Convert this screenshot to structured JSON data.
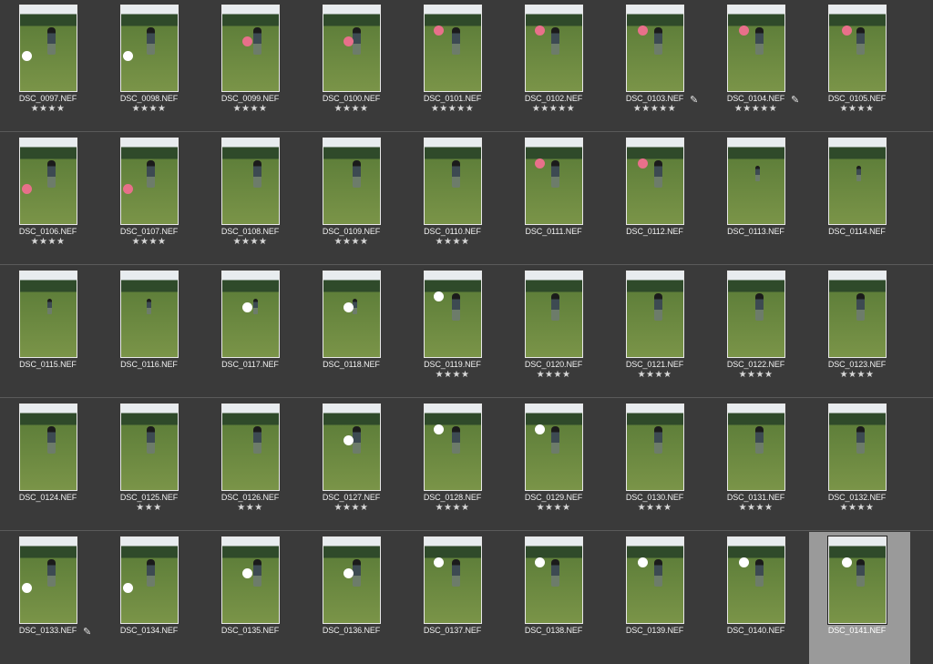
{
  "rows": [
    [
      {
        "name": "DSC_0097.NEF",
        "stars": "★★★★",
        "ball": "#ffffff",
        "pen": false
      },
      {
        "name": "DSC_0098.NEF",
        "stars": "★★★★",
        "ball": "#ffffff",
        "pen": false
      },
      {
        "name": "DSC_0099.NEF",
        "stars": "★★★★",
        "ball": "#e8708a",
        "pen": false
      },
      {
        "name": "DSC_0100.NEF",
        "stars": "★★★★",
        "ball": "#e8708a",
        "pen": false
      },
      {
        "name": "DSC_0101.NEF",
        "stars": "★★★★★",
        "ball": "#e8708a",
        "pen": false
      },
      {
        "name": "DSC_0102.NEF",
        "stars": "★★★★★",
        "ball": "#e8708a",
        "pen": false
      },
      {
        "name": "DSC_0103.NEF",
        "stars": "★★★★★",
        "ball": "#e8708a",
        "pen": true
      },
      {
        "name": "DSC_0104.NEF",
        "stars": "★★★★★",
        "ball": "#e8708a",
        "pen": true
      },
      {
        "name": "DSC_0105.NEF",
        "stars": "★★★★",
        "ball": "#e8708a",
        "pen": false
      }
    ],
    [
      {
        "name": "DSC_0106.NEF",
        "stars": "★★★★",
        "ball": "#e8708a",
        "pen": false
      },
      {
        "name": "DSC_0107.NEF",
        "stars": "★★★★",
        "ball": "#e8708a",
        "pen": false
      },
      {
        "name": "DSC_0108.NEF",
        "stars": "★★★★",
        "ball": "",
        "pen": false
      },
      {
        "name": "DSC_0109.NEF",
        "stars": "★★★★",
        "ball": "",
        "pen": false
      },
      {
        "name": "DSC_0110.NEF",
        "stars": "★★★★",
        "ball": "",
        "pen": false
      },
      {
        "name": "DSC_0111.NEF",
        "stars": "",
        "ball": "#e8708a",
        "pen": false
      },
      {
        "name": "DSC_0112.NEF",
        "stars": "",
        "ball": "#e8708a",
        "pen": false
      },
      {
        "name": "DSC_0113.NEF",
        "stars": "",
        "ball": "",
        "pen": false
      },
      {
        "name": "DSC_0114.NEF",
        "stars": "",
        "ball": "",
        "pen": false
      }
    ],
    [
      {
        "name": "DSC_0115.NEF",
        "stars": "",
        "ball": "",
        "pen": false
      },
      {
        "name": "DSC_0116.NEF",
        "stars": "",
        "ball": "",
        "pen": false
      },
      {
        "name": "DSC_0117.NEF",
        "stars": "",
        "ball": "#ffffff",
        "pen": false
      },
      {
        "name": "DSC_0118.NEF",
        "stars": "",
        "ball": "#ffffff",
        "pen": false
      },
      {
        "name": "DSC_0119.NEF",
        "stars": "★★★★",
        "ball": "#ffffff",
        "pen": false
      },
      {
        "name": "DSC_0120.NEF",
        "stars": "★★★★",
        "ball": "",
        "pen": false
      },
      {
        "name": "DSC_0121.NEF",
        "stars": "★★★★",
        "ball": "",
        "pen": false
      },
      {
        "name": "DSC_0122.NEF",
        "stars": "★★★★",
        "ball": "",
        "pen": false
      },
      {
        "name": "DSC_0123.NEF",
        "stars": "★★★★",
        "ball": "",
        "pen": false
      }
    ],
    [
      {
        "name": "DSC_0124.NEF",
        "stars": "",
        "ball": "",
        "pen": false
      },
      {
        "name": "DSC_0125.NEF",
        "stars": "★★★",
        "ball": "",
        "pen": false
      },
      {
        "name": "DSC_0126.NEF",
        "stars": "★★★",
        "ball": "",
        "pen": false
      },
      {
        "name": "DSC_0127.NEF",
        "stars": "★★★★",
        "ball": "#ffffff",
        "pen": false
      },
      {
        "name": "DSC_0128.NEF",
        "stars": "★★★★",
        "ball": "#ffffff",
        "pen": false
      },
      {
        "name": "DSC_0129.NEF",
        "stars": "★★★★",
        "ball": "#ffffff",
        "pen": false
      },
      {
        "name": "DSC_0130.NEF",
        "stars": "★★★★",
        "ball": "",
        "pen": false
      },
      {
        "name": "DSC_0131.NEF",
        "stars": "★★★★",
        "ball": "",
        "pen": false
      },
      {
        "name": "DSC_0132.NEF",
        "stars": "★★★★",
        "ball": "",
        "pen": false
      }
    ],
    [
      {
        "name": "DSC_0133.NEF",
        "stars": "",
        "ball": "#ffffff",
        "pen": true
      },
      {
        "name": "DSC_0134.NEF",
        "stars": "",
        "ball": "#ffffff",
        "pen": false
      },
      {
        "name": "DSC_0135.NEF",
        "stars": "",
        "ball": "#ffffff",
        "pen": false
      },
      {
        "name": "DSC_0136.NEF",
        "stars": "",
        "ball": "#ffffff",
        "pen": false
      },
      {
        "name": "DSC_0137.NEF",
        "stars": "",
        "ball": "#ffffff",
        "pen": false
      },
      {
        "name": "DSC_0138.NEF",
        "stars": "",
        "ball": "#ffffff",
        "pen": false
      },
      {
        "name": "DSC_0139.NEF",
        "stars": "",
        "ball": "#ffffff",
        "pen": false
      },
      {
        "name": "DSC_0140.NEF",
        "stars": "",
        "ball": "#ffffff",
        "pen": false
      },
      {
        "name": "DSC_0141.NEF",
        "stars": "",
        "ball": "#ffffff",
        "pen": false,
        "selected": true
      }
    ]
  ],
  "pen_glyph": "✎"
}
